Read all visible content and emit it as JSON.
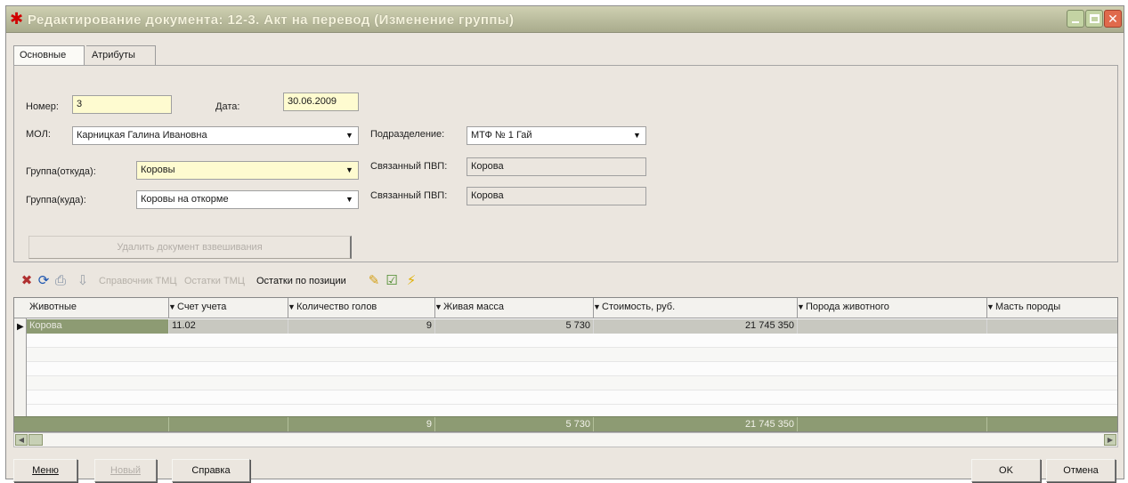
{
  "window": {
    "title": "Редактирование документа: 12-3. Акт на перевод (Изменение группы)"
  },
  "tabs": [
    {
      "label": "Основные",
      "active": true
    },
    {
      "label": "Атрибуты",
      "active": false
    }
  ],
  "form": {
    "number_label": "Номер:",
    "number_value": "3",
    "date_label": "Дата:",
    "date_value": "30.06.2009",
    "mol_label": "МОЛ:",
    "mol_value": "Карницкая Галина Ивановна",
    "division_label": "Подразделение:",
    "division_value": "МТФ № 1 Гай",
    "group_from_label": "Группа(откуда):",
    "group_from_value": "Коровы",
    "group_to_label": "Группа(куда):",
    "group_to_value": "Коровы на откорме",
    "linked_pvp_label_1": "Связанный ПВП:",
    "linked_pvp_value_1": "Корова",
    "linked_pvp_label_2": "Связанный ПВП:",
    "linked_pvp_value_2": "Корова",
    "delete_weighing_button": "Удалить документ взвешивания"
  },
  "toolbar": {
    "tmc_reference": "Справочник ТМЦ",
    "tmc_balances": "Остатки ТМЦ",
    "position_balances": "Остатки по позиции"
  },
  "grid": {
    "columns": [
      "Животные",
      "Счет учета",
      "Количество голов",
      "Живая масса",
      "Стоимость, руб.",
      "Порода животного",
      "Масть породы"
    ],
    "rows": [
      {
        "animal": "Корова",
        "account": "11.02",
        "heads": "9",
        "live_weight": "5 730",
        "cost": "21 745 350",
        "breed": "",
        "color": ""
      }
    ],
    "totals": {
      "heads": "9",
      "live_weight": "5 730",
      "cost": "21 745 350"
    }
  },
  "buttons": {
    "menu": "Меню",
    "new": "Новый",
    "help": "Справка",
    "ok": "OK",
    "cancel": "Отмена"
  },
  "colors": {
    "window_bg": "#ebe6df",
    "title_bar": "#babc9d",
    "required_field": "#fefbd0",
    "grid_accent": "#8d9b73"
  }
}
